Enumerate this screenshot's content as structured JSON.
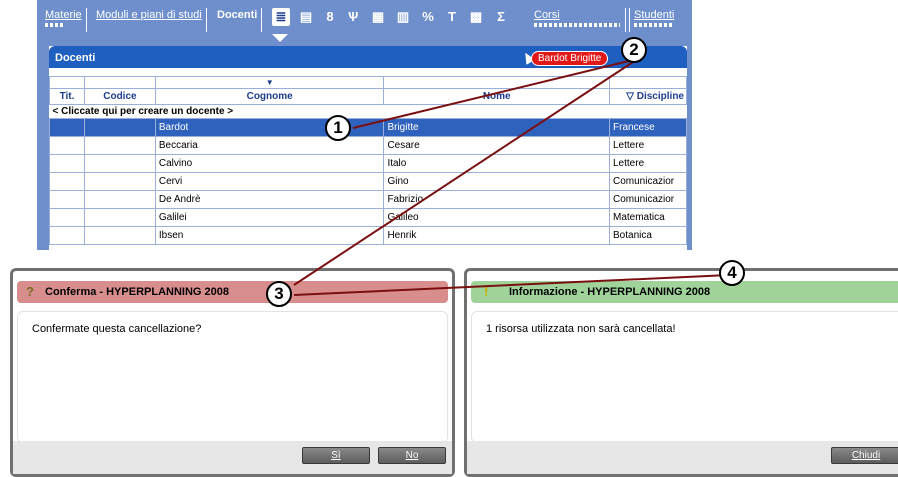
{
  "tabs": {
    "materie": "Materie",
    "moduli": "Moduli e piani di studi",
    "docenti": "Docenti",
    "corsi": "Corsi",
    "studenti": "Studenti"
  },
  "toolbar": {
    "tools": [
      "≣",
      "▤",
      "8",
      "Ѱ",
      "▦",
      "▥",
      "%",
      "T",
      "▩",
      "Σ"
    ]
  },
  "panel": {
    "title": "Docenti",
    "drag_tag": "Bardot Brigitte"
  },
  "table": {
    "headers": [
      "Tit.",
      "Codice",
      "Cognome",
      "Nome",
      "Discipline"
    ],
    "create_row": "< Cliccate qui per creare un docente >",
    "rows": [
      {
        "tit": "",
        "codice": "",
        "cognome": "Bardot",
        "nome": "Brigitte",
        "disciplina": "Francese",
        "selected": true
      },
      {
        "tit": "",
        "codice": "",
        "cognome": "Beccaria",
        "nome": "Cesare",
        "disciplina": "Lettere"
      },
      {
        "tit": "",
        "codice": "",
        "cognome": "Calvino",
        "nome": "Italo",
        "disciplina": "Lettere"
      },
      {
        "tit": "",
        "codice": "",
        "cognome": "Cervi",
        "nome": "Gino",
        "disciplina": "Comunicazior"
      },
      {
        "tit": "",
        "codice": "",
        "cognome": "De Andrè",
        "nome": "Fabrizio",
        "disciplina": "Comunicazior"
      },
      {
        "tit": "",
        "codice": "",
        "cognome": "Galilei",
        "nome": "Galileo",
        "disciplina": "Matematica"
      },
      {
        "tit": "",
        "codice": "",
        "cognome": "Ibsen",
        "nome": "Henrik",
        "disciplina": "Botanica"
      }
    ]
  },
  "callouts": [
    "1",
    "2",
    "3",
    "4"
  ],
  "confirm_dialog": {
    "icon": "question-icon",
    "title": "Conferma - HYPERPLANNING 2008",
    "message": "Confermate questa cancellazione?",
    "yes": "Sì",
    "no": "No",
    "header_color": "#d98e8e"
  },
  "info_dialog": {
    "icon": "exclamation-icon",
    "title": "Informazione - HYPERPLANNING 2008",
    "message": "1 risorsa utilizzata non sarà cancellata!",
    "close": "Chiudi",
    "header_color": "#9fd39a"
  },
  "colors": {
    "app_bg": "#6e8fcb",
    "title_bar": "#1f5fbf",
    "selection": "#2f62bc",
    "drag_tag": "#e01818",
    "connector": "#7a0f0f"
  }
}
